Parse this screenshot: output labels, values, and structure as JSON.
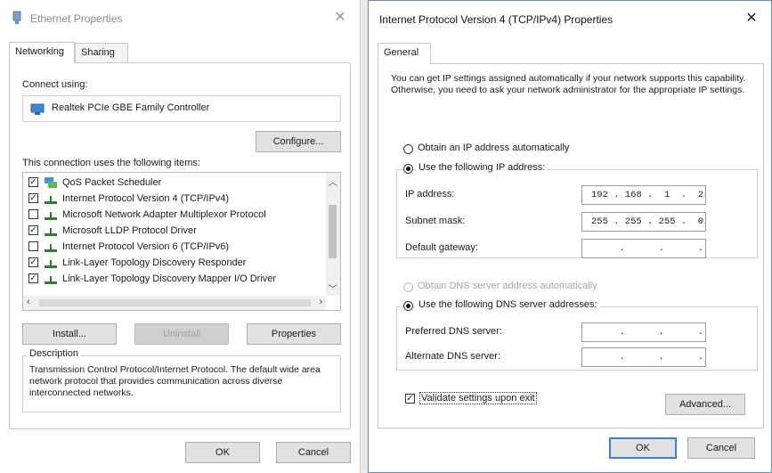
{
  "left_dialog": {
    "title": "Ethernet Properties",
    "close_glyph": "✕",
    "tabs": [
      {
        "label": "Networking"
      },
      {
        "label": "Sharing"
      }
    ],
    "connect_using_label": "Connect using:",
    "adapter_name": "Realtek PCIe GBE Family Controller",
    "configure_label": "Configure...",
    "items_label": "This connection uses the following items:",
    "items": [
      {
        "label": "QoS Packet Scheduler",
        "checked": true,
        "icon": "network-scheduler-icon"
      },
      {
        "label": "Internet Protocol Version 4 (TCP/IPv4)",
        "checked": true,
        "icon": "network-protocol-icon",
        "selected": true
      },
      {
        "label": "Microsoft Network Adapter Multiplexor Protocol",
        "checked": false,
        "icon": "network-protocol-icon"
      },
      {
        "label": "Microsoft LLDP Protocol Driver",
        "checked": true,
        "icon": "network-protocol-icon"
      },
      {
        "label": "Internet Protocol Version 6 (TCP/IPv6)",
        "checked": false,
        "icon": "network-protocol-icon"
      },
      {
        "label": "Link-Layer Topology Discovery Responder",
        "checked": true,
        "icon": "network-protocol-icon"
      },
      {
        "label": "Link-Layer Topology Discovery Mapper I/O Driver",
        "checked": true,
        "icon": "network-protocol-icon"
      }
    ],
    "install_label": "Install...",
    "uninstall_label": "Uninstall",
    "properties_label": "Properties",
    "description_title": "Description",
    "description_text": "Transmission Control Protocol/Internet Protocol. The default wide area network protocol that provides communication across diverse interconnected networks.",
    "ok_label": "OK",
    "cancel_label": "Cancel"
  },
  "right_dialog": {
    "title": "Internet Protocol Version 4 (TCP/IPv4) Properties",
    "close_glyph": "✕",
    "tabs": [
      {
        "label": "General"
      }
    ],
    "intro_text": "You can get IP settings assigned automatically if your network supports this capability. Otherwise, you need to ask your network administrator for the appropriate IP settings.",
    "obtain_ip_auto_label": "Obtain an IP address automatically",
    "use_following_ip_label": "Use the following IP address:",
    "ip_address_label": "IP address:",
    "ip_address_value": "192 . 168 .  1  .  2",
    "subnet_mask_label": "Subnet mask:",
    "subnet_mask_value": "255 . 255 . 255 .  0",
    "default_gateway_label": "Default gateway:",
    "default_gateway_value": "     .      .      .",
    "obtain_dns_auto_label": "Obtain DNS server address automatically",
    "use_following_dns_label": "Use the following DNS server addresses:",
    "preferred_dns_label": "Preferred DNS server:",
    "preferred_dns_value": "     .      .      .",
    "alternate_dns_label": "Alternate DNS server:",
    "alternate_dns_value": "     .      .      .",
    "validate_label": "Validate settings upon exit",
    "validate_checked": true,
    "advanced_label": "Advanced...",
    "ok_label": "OK",
    "cancel_label": "Cancel"
  }
}
